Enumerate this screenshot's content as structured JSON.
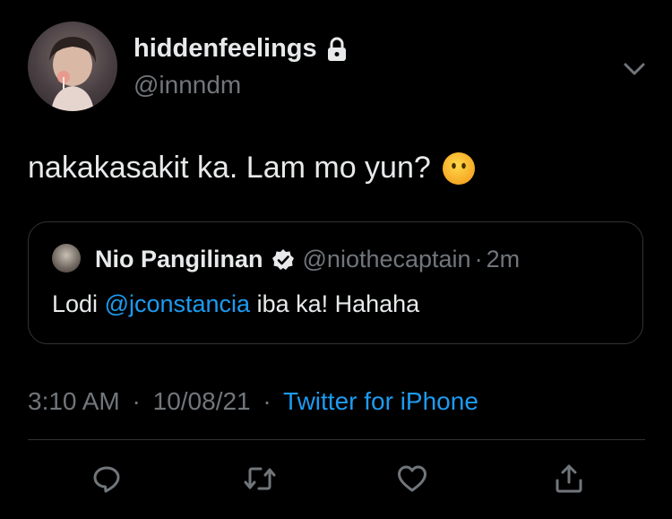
{
  "author": {
    "display_name": "hiddenfeelings",
    "username": "@innndm",
    "protected": true
  },
  "tweet": {
    "text": "nakakasakit ka. Lam mo yun?",
    "emoji": "face-without-mouth"
  },
  "quoted_tweet": {
    "display_name": "Nio Pangilinan",
    "verified": true,
    "username": "@niothecaptain",
    "dot": "·",
    "time": "2m",
    "text_before": "Lodi ",
    "mention": "@jconstancia",
    "text_after": " iba ka! Hahaha"
  },
  "meta": {
    "time": "3:10 AM",
    "sep1": "·",
    "date": "10/08/21",
    "sep2": "·",
    "source": "Twitter for iPhone"
  },
  "actions": [
    "reply-icon",
    "retweet-icon",
    "like-icon",
    "share-icon"
  ],
  "colors": {
    "background": "#000000",
    "text": "#e7e9ea",
    "muted": "#71767b",
    "accent": "#1d9bf0",
    "border": "#2f3336"
  }
}
